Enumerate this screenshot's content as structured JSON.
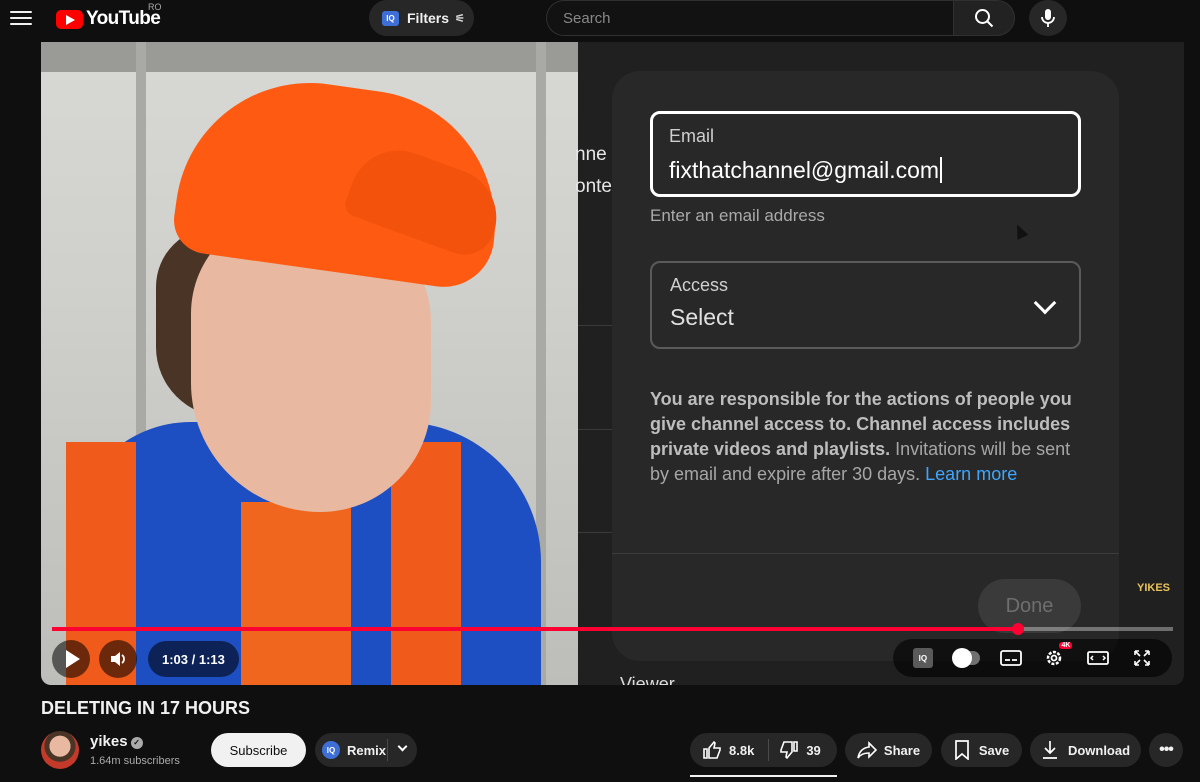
{
  "header": {
    "logo_text": "YouTube",
    "region": "RO",
    "filters_label": "Filters",
    "iq_badge": "IQ",
    "search_placeholder": "Search"
  },
  "dialog": {
    "email_label": "Email",
    "email_value": "fixthatchannel@gmail.com",
    "email_hint": "Enter an email address",
    "access_label": "Access",
    "access_value": "Select",
    "notice_bold": "You are responsible for the actions of people you give channel access to. Channel access includes private videos and playlists.",
    "notice_text": " Invitations will be sent by email and expire after 30 days. ",
    "learn_more": "Learn more",
    "done_label": "Done"
  },
  "background_text": {
    "line1": "nne",
    "line2": "onte",
    "viewer": "Viewer"
  },
  "watermark": "YIKES",
  "player": {
    "time": "1:03 / 1:13",
    "progress": 0.862,
    "quality_badge": "4K"
  },
  "video": {
    "title": "DELETING IN 17 HOURS",
    "channel": "yikes",
    "subscribers": "1.64m subscribers",
    "subscribe_label": "Subscribe",
    "remix_label": "Remix",
    "likes": "8.8k",
    "dislikes": "39",
    "share_label": "Share",
    "save_label": "Save",
    "download_label": "Download"
  },
  "colors": {
    "accent_red": "#ff0033",
    "link_blue": "#3ea6ff",
    "iq_blue": "#3d6fd6"
  }
}
